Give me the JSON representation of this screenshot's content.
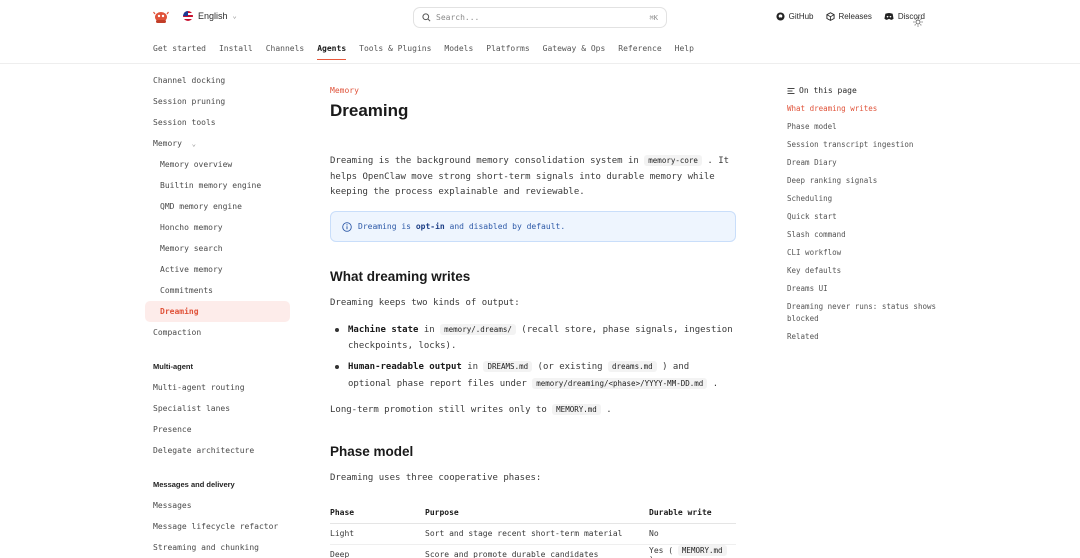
{
  "header": {
    "language": "English",
    "search_placeholder": "Search...",
    "search_shortcut": "⌘K",
    "links": [
      "GitHub",
      "Releases",
      "Discord"
    ]
  },
  "tabs": [
    {
      "label": "Get started",
      "active": false
    },
    {
      "label": "Install",
      "active": false
    },
    {
      "label": "Channels",
      "active": false
    },
    {
      "label": "Agents",
      "active": true
    },
    {
      "label": "Tools & Plugins",
      "active": false
    },
    {
      "label": "Models",
      "active": false
    },
    {
      "label": "Platforms",
      "active": false
    },
    {
      "label": "Gateway & Ops",
      "active": false
    },
    {
      "label": "Reference",
      "active": false
    },
    {
      "label": "Help",
      "active": false
    }
  ],
  "sidebar": {
    "items_top": [
      "Channel docking",
      "Session pruning",
      "Session tools"
    ],
    "memory_label": "Memory",
    "memory_items": [
      "Memory overview",
      "Builtin memory engine",
      "QMD memory engine",
      "Honcho memory",
      "Memory search",
      "Active memory",
      "Commitments",
      "Dreaming"
    ],
    "active_item": "Dreaming",
    "after_memory": "Compaction",
    "group_multi_agent": "Multi-agent",
    "multi_agent_items": [
      "Multi-agent routing",
      "Specialist lanes",
      "Presence",
      "Delegate architecture"
    ],
    "group_messages": "Messages and delivery",
    "messages_items": [
      "Messages",
      "Message lifecycle refactor",
      "Streaming and chunking"
    ]
  },
  "content": {
    "eyebrow": "Memory",
    "title": "Dreaming",
    "intro_1": "Dreaming is the background memory consolidation system in",
    "intro_code": "memory-core",
    "intro_2": ". It helps OpenClaw move strong short-term signals into durable memory while keeping the process explainable and reviewable.",
    "callout_1": "Dreaming is",
    "callout_bold": "opt-in",
    "callout_2": "and disabled by default.",
    "h_writes": "What dreaming writes",
    "writes_intro": "Dreaming keeps two kinds of output:",
    "bullet1_bold": "Machine state",
    "bullet1_in": "in",
    "bullet1_code": "memory/.dreams/",
    "bullet1_rest": "(recall store, phase signals, ingestion checkpoints, locks).",
    "bullet2_bold": "Human-readable output",
    "bullet2_in": "in",
    "bullet2_code1": "DREAMS.md",
    "bullet2_mid": "(or existing",
    "bullet2_code2": "dreams.md",
    "bullet2_rest": ") and optional phase report files under",
    "bullet2_code3": "memory/dreaming/<phase>/YYYY-MM-DD.md",
    "bullet2_end": ".",
    "promo_1": "Long-term promotion still writes only to",
    "promo_code": "MEMORY.md",
    "promo_2": ".",
    "h_phase": "Phase model",
    "phase_intro": "Dreaming uses three cooperative phases:",
    "table_headers": [
      "Phase",
      "Purpose",
      "Durable write"
    ],
    "table_rows": [
      [
        "Light",
        "Sort and stage recent short-term material",
        "No"
      ],
      [
        "Deep",
        "Score and promote durable candidates",
        "Yes ("
      ]
    ],
    "deep_code": "MEMORY.md",
    "deep_close": ")"
  },
  "toc": {
    "heading": "On this page",
    "items": [
      "What dreaming writes",
      "Phase model",
      "Session transcript ingestion",
      "Dream Diary",
      "Deep ranking signals",
      "Scheduling",
      "Quick start",
      "Slash command",
      "CLI workflow",
      "Key defaults",
      "Dreams UI",
      "Dreaming never runs: status shows blocked",
      "Related"
    ]
  },
  "colors": {
    "accent": "#e0533a",
    "callout_bg": "#eef5fe",
    "callout_border": "#c9defa"
  }
}
